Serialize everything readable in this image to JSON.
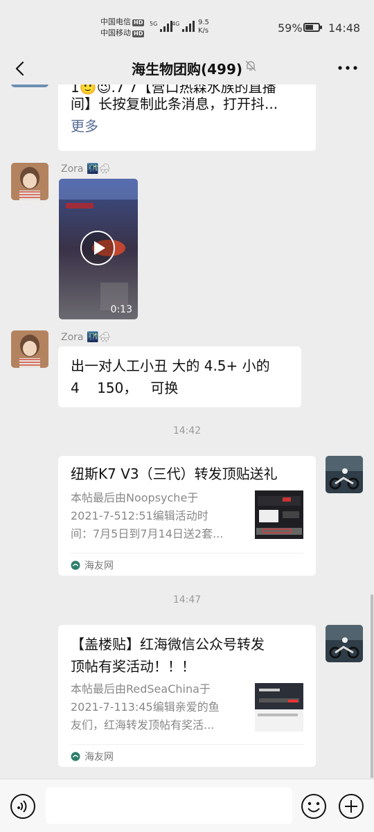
{
  "status_bar": {
    "carrier1": "中国电信",
    "carrier2": "中国移动",
    "hd": "HD",
    "net1": "5G",
    "net2": "4G",
    "speed_value": "9.5",
    "speed_unit": "K/s",
    "battery_text": "59%",
    "battery_level": 0.59,
    "time": "14:48"
  },
  "nav": {
    "title": "海生物团购(499)"
  },
  "messages": {
    "partial": {
      "line1": "1🙂😉.7 7【营口热森水族的直播",
      "line2": "间】长按复制此条消息，打开抖...",
      "more": "更多"
    },
    "video": {
      "sender": "Zora 🌃🌧",
      "duration": "0:13"
    },
    "text_msg": {
      "sender": "Zora 🌃🌧",
      "line1": "出一对人工小丑  大的 4.5+ 小的",
      "line2": "4    150，   可换"
    },
    "time1": "14:42",
    "card1": {
      "title": "纽斯K7 V3（三代）转发顶贴送礼",
      "desc1": "本帖最后由Noopsyche于",
      "desc2": "2021-7-512:51编辑活动时",
      "desc3": "间：7月5日到7月14日送2套...",
      "source": "海友网"
    },
    "time2": "14:47",
    "card2": {
      "title1": "【盖楼贴】红海微信公众号转发",
      "title2": "顶帖有奖活动！！！",
      "desc1": "本帖最后由RedSeaChina于",
      "desc2": "2021-7-113:45编辑亲爱的鱼",
      "desc3": "友们，红海转发顶帖有奖活...",
      "source": "海友网"
    }
  },
  "icons": {
    "back": "back-arrow-icon",
    "mute": "mute-bell-icon",
    "more": "more-dots-icon",
    "voice": "voice-icon",
    "emoji": "emoji-icon",
    "plus": "plus-icon",
    "play": "play-icon",
    "source": "source-logo-icon"
  },
  "colors": {
    "background": "#ededed",
    "bubble": "#ffffff",
    "muted_text": "#888888"
  }
}
